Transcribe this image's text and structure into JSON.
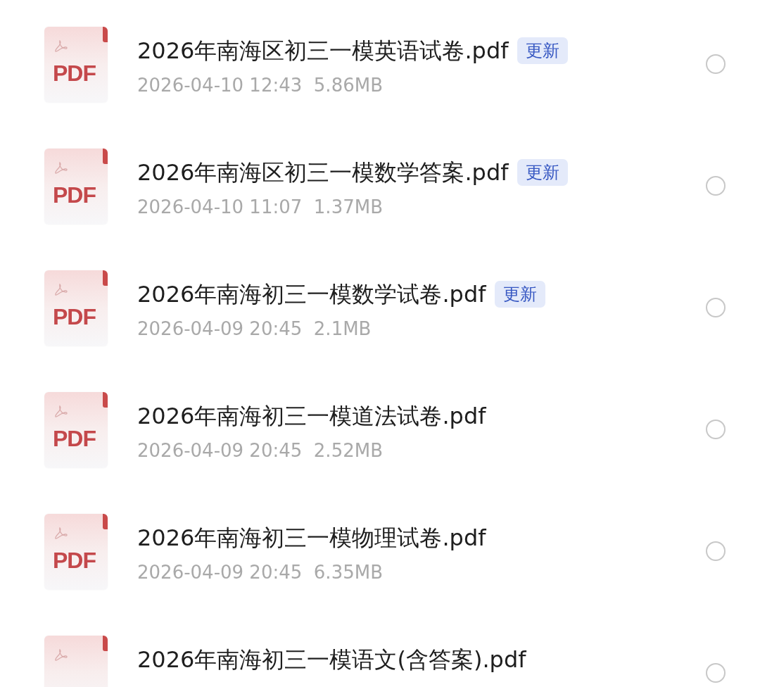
{
  "files": [
    {
      "icon_label": "PDF",
      "name": "2026年南海区初三一模英语试卷.pdf",
      "badge": "更新",
      "meta": "2026-04-10 12:43  5.86MB",
      "selected": false
    },
    {
      "icon_label": "PDF",
      "name": "2026年南海区初三一模数学答案.pdf",
      "badge": "更新",
      "meta": "2026-04-10 11:07  1.37MB",
      "selected": false
    },
    {
      "icon_label": "PDF",
      "name": "2026年南海初三一模数学试卷.pdf",
      "badge": "更新",
      "meta": "2026-04-09 20:45  2.1MB",
      "selected": false
    },
    {
      "icon_label": "PDF",
      "name": "2026年南海初三一模道法试卷.pdf",
      "meta": "2026-04-09 20:45  2.52MB",
      "selected": false
    },
    {
      "icon_label": "PDF",
      "name": "2026年南海初三一模物理试卷.pdf",
      "meta": "2026-04-09 20:45  6.35MB",
      "selected": false
    },
    {
      "name": "2026年南海初三一模语文(含答案).pdf",
      "selected": false
    }
  ]
}
